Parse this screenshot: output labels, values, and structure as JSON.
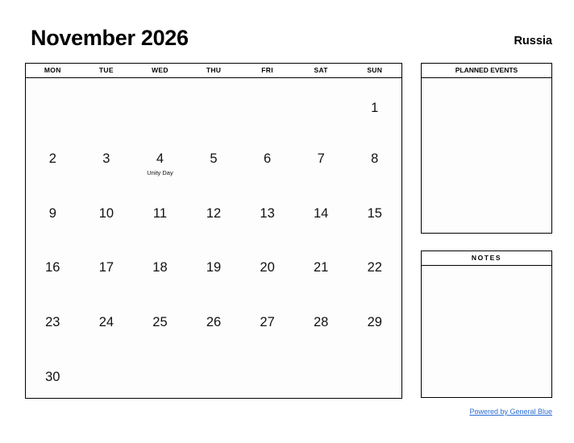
{
  "header": {
    "month_title": "November 2026",
    "region": "Russia"
  },
  "calendar": {
    "weekday_headers": [
      "MON",
      "TUE",
      "WED",
      "THU",
      "FRI",
      "SAT",
      "SUN"
    ],
    "weeks": [
      [
        {
          "day": ""
        },
        {
          "day": ""
        },
        {
          "day": ""
        },
        {
          "day": ""
        },
        {
          "day": ""
        },
        {
          "day": ""
        },
        {
          "day": "1"
        }
      ],
      [
        {
          "day": "2"
        },
        {
          "day": "3"
        },
        {
          "day": "4",
          "holiday": "Unity Day"
        },
        {
          "day": "5"
        },
        {
          "day": "6"
        },
        {
          "day": "7"
        },
        {
          "day": "8"
        }
      ],
      [
        {
          "day": "9"
        },
        {
          "day": "10"
        },
        {
          "day": "11"
        },
        {
          "day": "12"
        },
        {
          "day": "13"
        },
        {
          "day": "14"
        },
        {
          "day": "15"
        }
      ],
      [
        {
          "day": "16"
        },
        {
          "day": "17"
        },
        {
          "day": "18"
        },
        {
          "day": "19"
        },
        {
          "day": "20"
        },
        {
          "day": "21"
        },
        {
          "day": "22"
        }
      ],
      [
        {
          "day": "23"
        },
        {
          "day": "24"
        },
        {
          "day": "25"
        },
        {
          "day": "26"
        },
        {
          "day": "27"
        },
        {
          "day": "28"
        },
        {
          "day": "29"
        }
      ],
      [
        {
          "day": "30"
        },
        {
          "day": ""
        },
        {
          "day": ""
        },
        {
          "day": ""
        },
        {
          "day": ""
        },
        {
          "day": ""
        },
        {
          "day": ""
        }
      ]
    ]
  },
  "panels": {
    "planned_events": {
      "title": "PLANNED EVENTS",
      "content": ""
    },
    "notes": {
      "title": "NOTES",
      "content": ""
    }
  },
  "footer": {
    "link_text": "Powered by General Blue",
    "link_color": "#2b6cd4"
  }
}
